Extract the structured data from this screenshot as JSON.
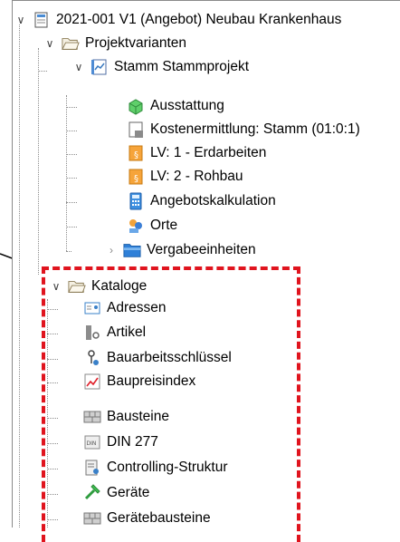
{
  "tree": {
    "root": {
      "label": "2021-001 V1 (Angebot) Neubau Krankenhaus",
      "icon": "project-doc-icon"
    },
    "variants": {
      "label": "Projektvarianten",
      "icon": "folder-open-icon"
    },
    "stamm": {
      "label": "Stamm Stammprojekt",
      "icon": "project-variant-icon"
    },
    "stamm_children": [
      {
        "label": "Ausstattung",
        "icon": "cube-icon"
      },
      {
        "label": "Kostenermittlung: Stamm (01:0:1)",
        "icon": "cost-sheet-icon"
      },
      {
        "label": "LV: 1 - Erdarbeiten",
        "icon": "lv-document-icon"
      },
      {
        "label": "LV: 2 - Rohbau",
        "icon": "lv-document-icon"
      },
      {
        "label": "Angebotskalkulation",
        "icon": "calculator-icon"
      },
      {
        "label": "Orte",
        "icon": "places-icon"
      },
      {
        "label": "Vergabeeinheiten",
        "icon": "folder-icon"
      }
    ],
    "kataloge": {
      "label": "Kataloge",
      "icon": "folder-open-icon"
    },
    "kataloge_children": [
      {
        "label": "Adressen",
        "icon": "address-card-icon"
      },
      {
        "label": "Artikel",
        "icon": "article-icon"
      },
      {
        "label": "Bauarbeitsschlüssel",
        "icon": "key-icon"
      },
      {
        "label": "Baupreisindex",
        "icon": "price-index-chart-icon"
      },
      {
        "label": "Bausteine",
        "icon": "bricks-icon"
      },
      {
        "label": "DIN 277",
        "icon": "din-icon"
      },
      {
        "label": "Controlling-Struktur",
        "icon": "controlling-icon"
      },
      {
        "label": "Geräte",
        "icon": "hammer-icon"
      },
      {
        "label": "Gerätebausteine",
        "icon": "bricks-icon"
      }
    ]
  },
  "colors": {
    "highlight_box": "#e0141e",
    "arrow": "#000000",
    "folder": "#f5f0e2"
  }
}
